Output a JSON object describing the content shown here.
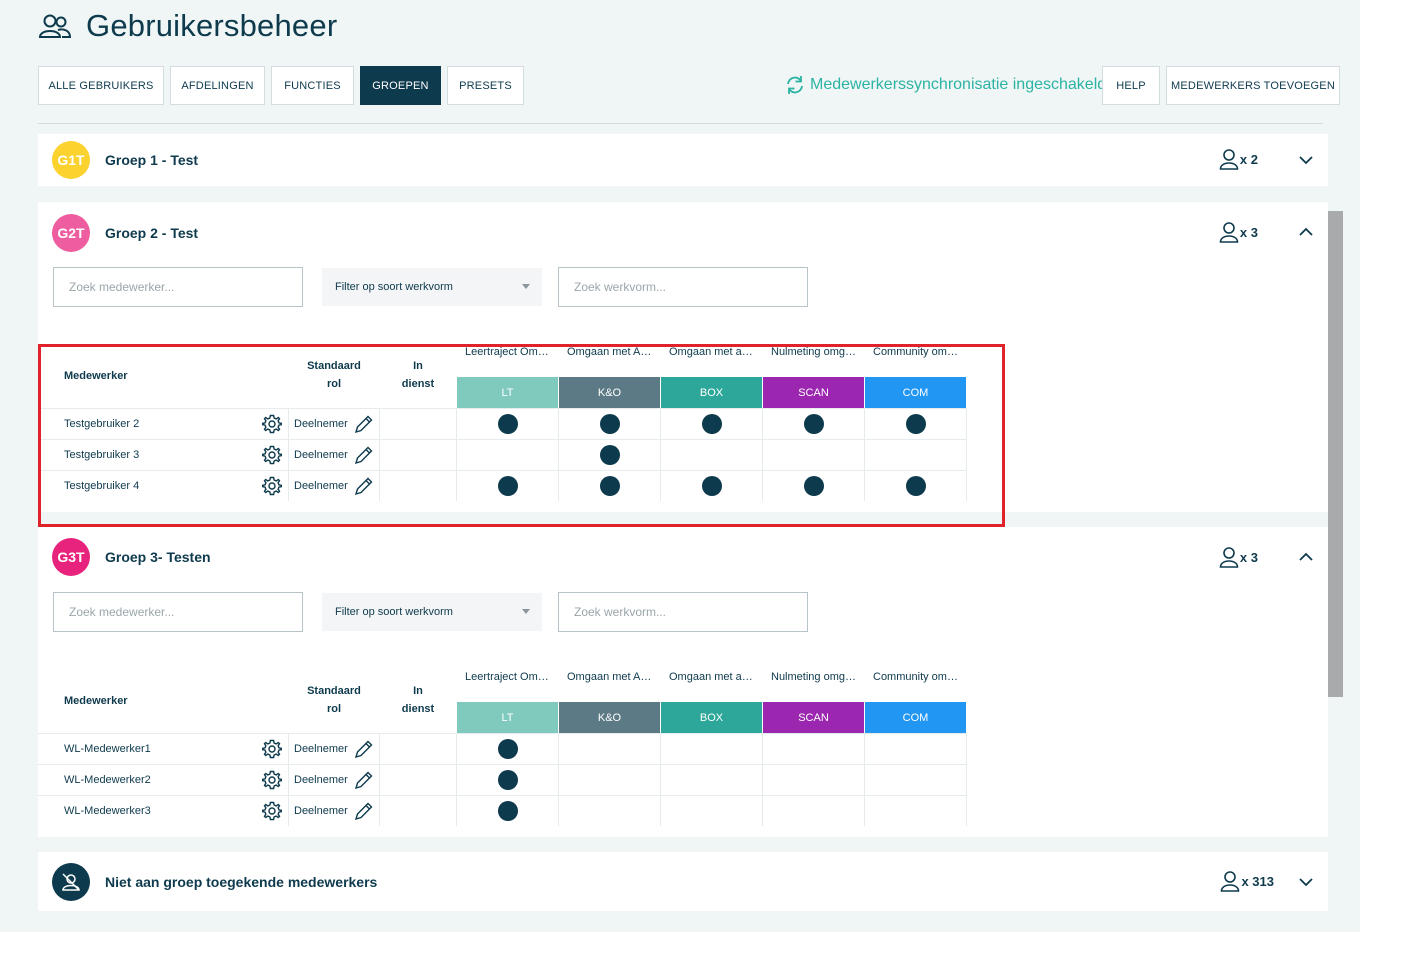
{
  "header": {
    "title": "Gebruikersbeheer",
    "icon": "users-icon"
  },
  "tabs": [
    {
      "label": "ALLE GEBRUIKERS",
      "active": false
    },
    {
      "label": "AFDELINGEN",
      "active": false
    },
    {
      "label": "FUNCTIES",
      "active": false
    },
    {
      "label": "GROEPEN",
      "active": true
    },
    {
      "label": "PRESETS",
      "active": false
    }
  ],
  "sync": {
    "label": "Medewerkerssynchronisatie ingeschakeld",
    "icon": "sync-icon"
  },
  "actions": {
    "help": "HELP",
    "add_employees": "MEDEWERKERS TOEVOEGEN"
  },
  "colors": {
    "LT": "#7fc9bd",
    "KO": "#5c7a85",
    "BOX": "#2ca79a",
    "SCAN": "#9b27b0",
    "COM": "#2196f3",
    "G1T": "#fbd22e",
    "G2T": "#ee5d9f",
    "G3T": "#e8237d",
    "none": "#0e3a4d",
    "accent": "#2bb3a3"
  },
  "groups": {
    "g1": {
      "initials": "G1T",
      "name": "Groep 1 - Test",
      "count": "x 2"
    },
    "g2": {
      "initials": "G2T",
      "name": "Groep 2 - Test",
      "count": "x 3",
      "search_placeholder": "Zoek medewerker...",
      "filter_label": "Filter op soort werkvorm",
      "search_form_placeholder": "Zoek werkvorm...",
      "headers": {
        "employee": "Medewerker",
        "role_line1": "Standaard",
        "role_line2": "rol",
        "service_line1": "In",
        "service_line2": "dienst"
      },
      "columns": [
        {
          "title": "Leertraject Omgaan met Agressie",
          "badge": "LT"
        },
        {
          "title": "Omgaan met Agressie",
          "badge": "K&O"
        },
        {
          "title": "Omgaan met agressie",
          "badge": "BOX"
        },
        {
          "title": "Nulmeting omgaan met agressie",
          "badge": "SCAN"
        },
        {
          "title": "Community omgaan met agressie",
          "badge": "COM"
        }
      ],
      "rows": [
        {
          "name": "Testgebruiker 2",
          "role": "Deelnemer",
          "dots": [
            true,
            true,
            true,
            true,
            true
          ]
        },
        {
          "name": "Testgebruiker 3",
          "role": "Deelnemer",
          "dots": [
            false,
            true,
            false,
            false,
            false
          ]
        },
        {
          "name": "Testgebruiker 4",
          "role": "Deelnemer",
          "dots": [
            true,
            true,
            true,
            true,
            true
          ]
        }
      ]
    },
    "g3": {
      "initials": "G3T",
      "name": "Groep 3- Testen",
      "count": "x 3",
      "search_placeholder": "Zoek medewerker...",
      "filter_label": "Filter op soort werkvorm",
      "search_form_placeholder": "Zoek werkvorm...",
      "headers": {
        "employee": "Medewerker",
        "role_line1": "Standaard",
        "role_line2": "rol",
        "service_line1": "In",
        "service_line2": "dienst"
      },
      "columns": [
        {
          "title": "Leertraject Omgaan met Agressie",
          "badge": "LT"
        },
        {
          "title": "Omgaan met Agressie",
          "badge": "K&O"
        },
        {
          "title": "Omgaan met agressie",
          "badge": "BOX"
        },
        {
          "title": "Nulmeting omgaan met agressie",
          "badge": "SCAN"
        },
        {
          "title": "Community omgaan met agressie",
          "badge": "COM"
        }
      ],
      "rows": [
        {
          "name": "WL-Medewerker1",
          "role": "Deelnemer",
          "dots": [
            true,
            false,
            false,
            false,
            false
          ]
        },
        {
          "name": "WL-Medewerker2",
          "role": "Deelnemer",
          "dots": [
            true,
            false,
            false,
            false,
            false
          ]
        },
        {
          "name": "WL-Medewerker3",
          "role": "Deelnemer",
          "dots": [
            true,
            false,
            false,
            false,
            false
          ]
        }
      ]
    },
    "unassigned": {
      "name": "Niet aan groep toegekende medewerkers",
      "count": "x 313"
    }
  }
}
